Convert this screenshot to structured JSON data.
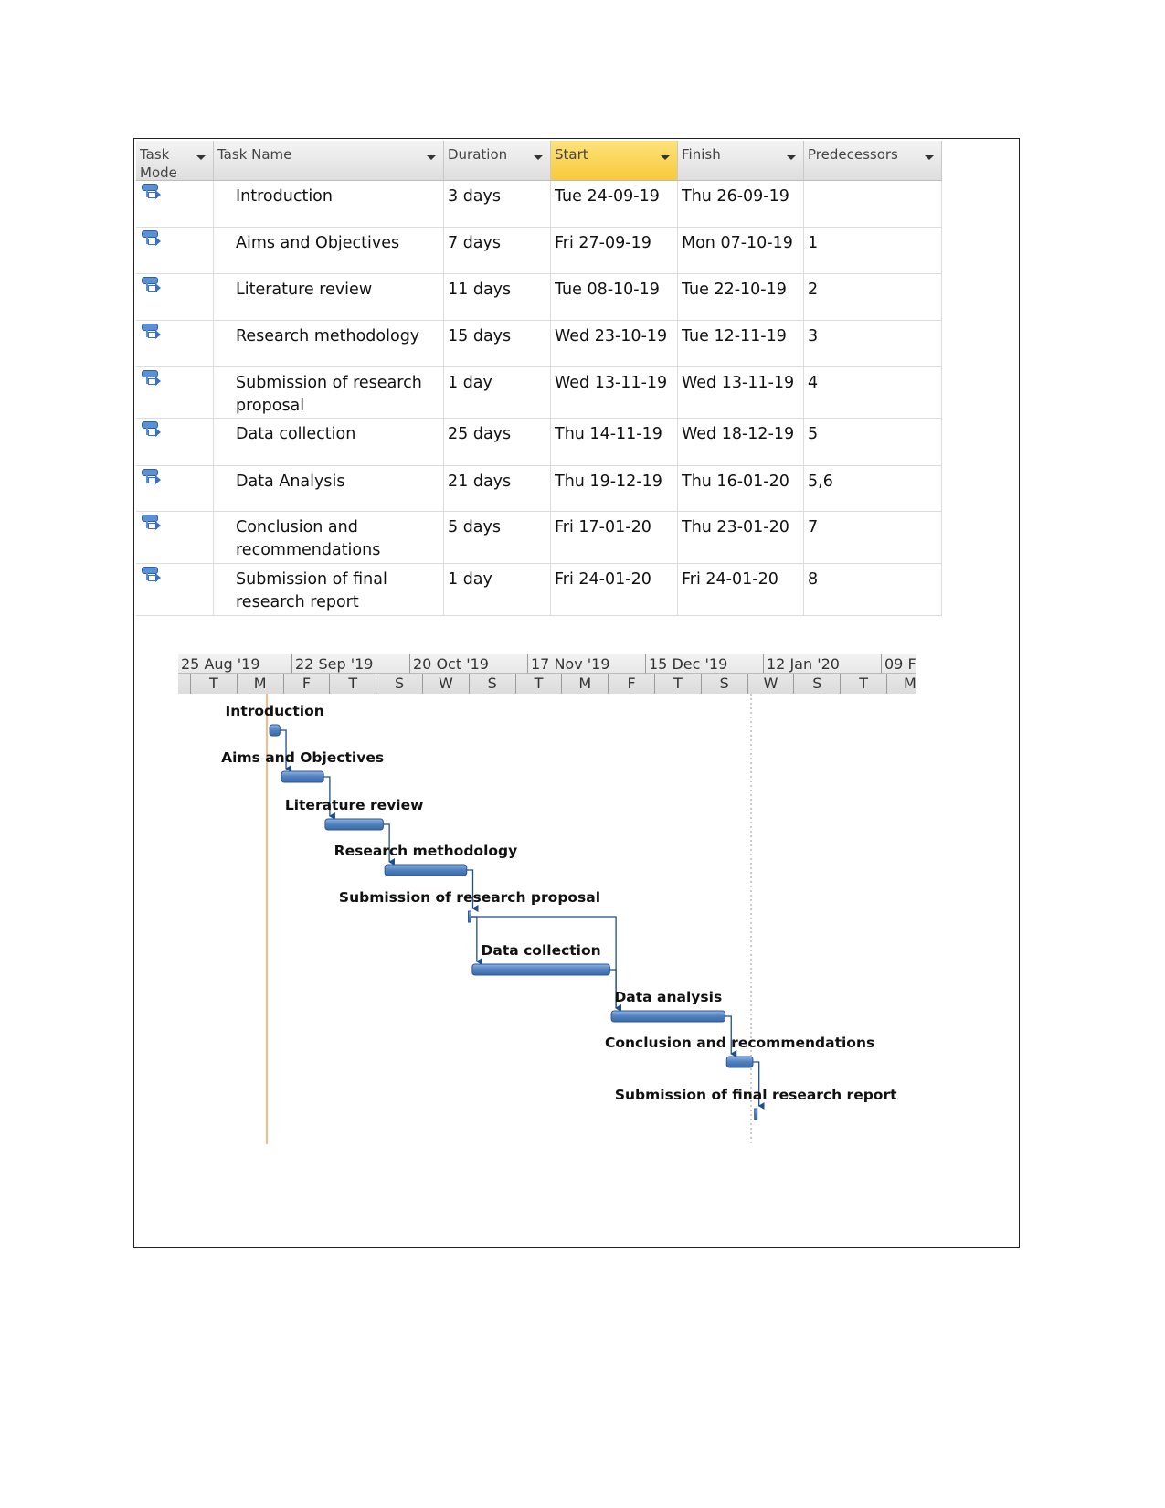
{
  "table": {
    "columns": [
      {
        "label": "Task Mode",
        "selected": false
      },
      {
        "label": "Task Name",
        "selected": false
      },
      {
        "label": "Duration",
        "selected": false
      },
      {
        "label": "Start",
        "selected": true
      },
      {
        "label": "Finish",
        "selected": false
      },
      {
        "label": "Predecessors",
        "selected": false
      }
    ],
    "rows": [
      {
        "mode_icon": "auto-scheduled-task-icon",
        "name": "Introduction",
        "duration": "3 days",
        "start": "Tue 24-09-19",
        "finish": "Thu 26-09-19",
        "predecessors": ""
      },
      {
        "mode_icon": "auto-scheduled-task-icon",
        "name": "Aims and Objectives",
        "duration": "7 days",
        "start": "Fri 27-09-19",
        "finish": "Mon 07-10-19",
        "predecessors": "1"
      },
      {
        "mode_icon": "auto-scheduled-task-icon",
        "name": "Literature review",
        "duration": "11 days",
        "start": "Tue 08-10-19",
        "finish": "Tue 22-10-19",
        "predecessors": "2"
      },
      {
        "mode_icon": "auto-scheduled-task-icon",
        "name": "Research methodology",
        "duration": "15 days",
        "start": "Wed 23-10-19",
        "finish": "Tue 12-11-19",
        "predecessors": "3"
      },
      {
        "mode_icon": "auto-scheduled-task-icon",
        "name": "Submission of research proposal",
        "duration": "1 day",
        "start": "Wed 13-11-19",
        "finish": "Wed 13-11-19",
        "predecessors": "4"
      },
      {
        "mode_icon": "auto-scheduled-task-icon",
        "name": "Data collection",
        "duration": "25 days",
        "start": "Thu 14-11-19",
        "finish": "Wed 18-12-19",
        "predecessors": "5"
      },
      {
        "mode_icon": "auto-scheduled-task-icon",
        "name": "Data Analysis",
        "duration": "21 days",
        "start": "Thu 19-12-19",
        "finish": "Thu 16-01-20",
        "predecessors": "5,6"
      },
      {
        "mode_icon": "auto-scheduled-task-icon",
        "name": "Conclusion and recommendations",
        "duration": "5 days",
        "start": "Fri 17-01-20",
        "finish": "Thu 23-01-20",
        "predecessors": "7"
      },
      {
        "mode_icon": "auto-scheduled-task-icon",
        "name": "Submission of final research report",
        "duration": "1 day",
        "start": "Fri 24-01-20",
        "finish": "Fri 24-01-20",
        "predecessors": "8"
      }
    ]
  },
  "chart_data": {
    "type": "gantt",
    "timescale_major": [
      "25 Aug '19",
      "22 Sep '19",
      "20 Oct '19",
      "17 Nov '19",
      "15 Dec '19",
      "12 Jan '20",
      "09 F"
    ],
    "timescale_minor": [
      "",
      "T",
      "M",
      "F",
      "T",
      "S",
      "W",
      "S",
      "T",
      "M",
      "F",
      "T",
      "S",
      "W",
      "S",
      "T",
      "M"
    ],
    "bar_labels": [
      "Introduction",
      "Aims and Objectives",
      "Literature review",
      "Research methodology",
      "Submission of research proposal",
      "Data collection",
      "Data analysis",
      "Conclusion and recommendations",
      "Submission of final research report"
    ],
    "bar_color": "#4f81bd",
    "bar_border_color": "#2f5597",
    "today_line_color": "#f4a460"
  }
}
